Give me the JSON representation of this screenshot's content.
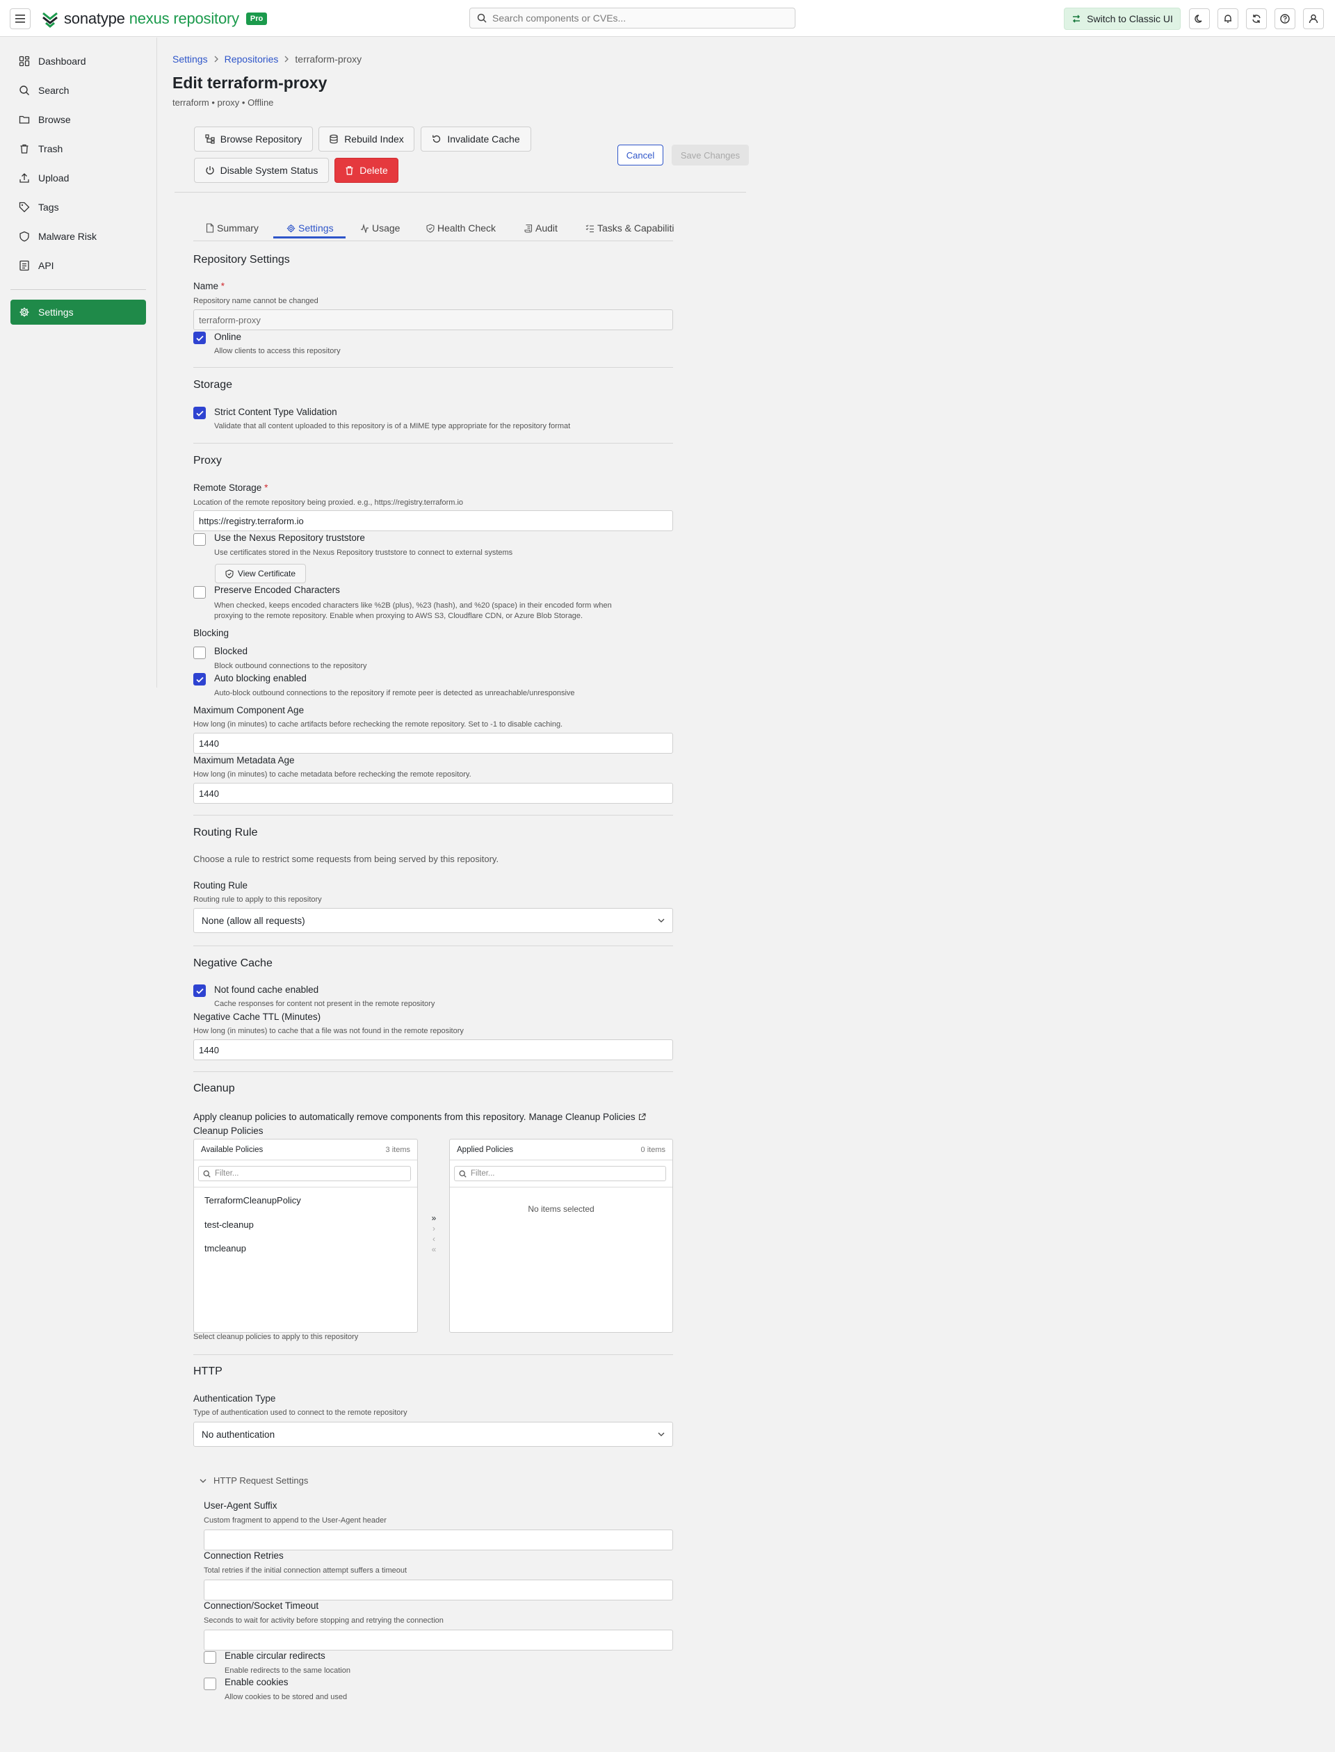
{
  "topbar": {
    "brand_name": "sonatype",
    "brand_product": "nexus repository",
    "brand_badge": "Pro",
    "search_placeholder": "Search components or CVEs...",
    "switch_classic_label": "Switch to Classic UI"
  },
  "sidebar": {
    "items": [
      {
        "label": "Dashboard",
        "icon": "dashboard-icon"
      },
      {
        "label": "Search",
        "icon": "search-icon"
      },
      {
        "label": "Browse",
        "icon": "folder-icon"
      },
      {
        "label": "Trash",
        "icon": "trash-icon"
      },
      {
        "label": "Upload",
        "icon": "upload-icon"
      },
      {
        "label": "Tags",
        "icon": "tag-icon"
      },
      {
        "label": "Malware Risk",
        "icon": "shield-icon"
      },
      {
        "label": "API",
        "icon": "api-icon"
      },
      {
        "label": "Settings",
        "icon": "gear-icon",
        "active": true
      }
    ]
  },
  "breadcrumb": {
    "items": [
      "Settings",
      "Repositories",
      "terraform-proxy"
    ]
  },
  "page": {
    "title": "Edit terraform-proxy",
    "subtitle": "terraform • proxy • Offline"
  },
  "actions": {
    "browse": "Browse Repository",
    "rebuild": "Rebuild Index",
    "invalidate": "Invalidate Cache",
    "disable": "Disable System Status",
    "delete": "Delete",
    "cancel": "Cancel",
    "save": "Save Changes"
  },
  "tabs": [
    "Summary",
    "Settings",
    "Usage",
    "Health Check",
    "Audit",
    "Tasks & Capabiliti"
  ],
  "repository_settings": {
    "title": "Repository Settings",
    "name_label": "Name",
    "name_help": "Repository name cannot be changed",
    "name_value": "terraform-proxy",
    "online_label": "Online",
    "online_help": "Allow clients to access this repository"
  },
  "storage": {
    "title": "Storage",
    "strict_label": "Strict Content Type Validation",
    "strict_help": "Validate that all content uploaded to this repository is of a MIME type appropriate for the repository format"
  },
  "proxy": {
    "title": "Proxy",
    "remote_label": "Remote Storage",
    "remote_help": "Location of the remote repository being proxied. e.g., https://registry.terraform.io",
    "remote_value": "https://registry.terraform.io",
    "truststore_label": "Use the Nexus Repository truststore",
    "truststore_help": "Use certificates stored in the Nexus Repository truststore to connect to external systems",
    "view_cert": "View Certificate",
    "preserve_label": "Preserve Encoded Characters",
    "preserve_help_1": "When checked, keeps encoded characters like %2B (plus), %23 (hash), and %20 (space) in their encoded form when",
    "preserve_help_2": "proxying to the remote repository. Enable when proxying to AWS S3, Cloudflare CDN, or Azure Blob Storage.",
    "blocking_title": "Blocking",
    "blocked_label": "Blocked",
    "blocked_help": "Block outbound connections to the repository",
    "auto_label": "Auto blocking enabled",
    "auto_help": "Auto-block outbound connections to the repository if remote peer is detected as unreachable/unresponsive",
    "max_comp_label": "Maximum Component Age",
    "max_comp_help": "How long (in minutes) to cache artifacts before rechecking the remote repository. Set to -1 to disable caching.",
    "max_comp_value": "1440",
    "max_meta_label": "Maximum Metadata Age",
    "max_meta_help": "How long (in minutes) to cache metadata before rechecking the remote repository.",
    "max_meta_value": "1440"
  },
  "routing": {
    "title": "Routing Rule",
    "desc": "Choose a rule to restrict some requests from being served by this repository.",
    "label": "Routing Rule",
    "help": "Routing rule to apply to this repository",
    "value": "None (allow all requests)"
  },
  "negative_cache": {
    "title": "Negative Cache",
    "enabled_label": "Not found cache enabled",
    "enabled_help": "Cache responses for content not present in the remote repository",
    "ttl_label": "Negative Cache TTL (Minutes)",
    "ttl_help": "How long (in minutes) to cache that a file was not found in the remote repository",
    "ttl_value": "1440"
  },
  "cleanup": {
    "title": "Cleanup",
    "desc": "Apply cleanup policies to automatically remove components from this repository.",
    "manage_link": "Manage Cleanup Policies",
    "policies_label": "Cleanup Policies",
    "available_title": "Available Policies",
    "available_count": "3 items",
    "applied_title": "Applied Policies",
    "applied_count": "0 items",
    "filter_placeholder": "Filter...",
    "available_items": [
      "TerraformCleanupPolicy",
      "test-cleanup",
      "tmcleanup"
    ],
    "applied_empty": "No items selected",
    "help": "Select cleanup policies to apply to this repository"
  },
  "http": {
    "title": "HTTP",
    "auth_label": "Authentication Type",
    "auth_help": "Type of authentication used to connect to the remote repository",
    "auth_value": "No authentication",
    "request_settings": "HTTP Request Settings",
    "ua_label": "User-Agent Suffix",
    "ua_help": "Custom fragment to append to the User-Agent header",
    "retries_label": "Connection Retries",
    "retries_help": "Total retries if the initial connection attempt suffers a timeout",
    "timeout_label": "Connection/Socket Timeout",
    "timeout_help": "Seconds to wait for activity before stopping and retrying the connection",
    "circular_label": "Enable circular redirects",
    "circular_help": "Enable redirects to the same location",
    "cookies_label": "Enable cookies",
    "cookies_help": "Allow cookies to be stored and used"
  },
  "colors": {
    "brand_green": "#1b9a4c",
    "active_nav": "#1f8a49",
    "link_blue": "#2e55c9",
    "checkbox_blue": "#2e43d1",
    "danger_red": "#e5393e"
  }
}
